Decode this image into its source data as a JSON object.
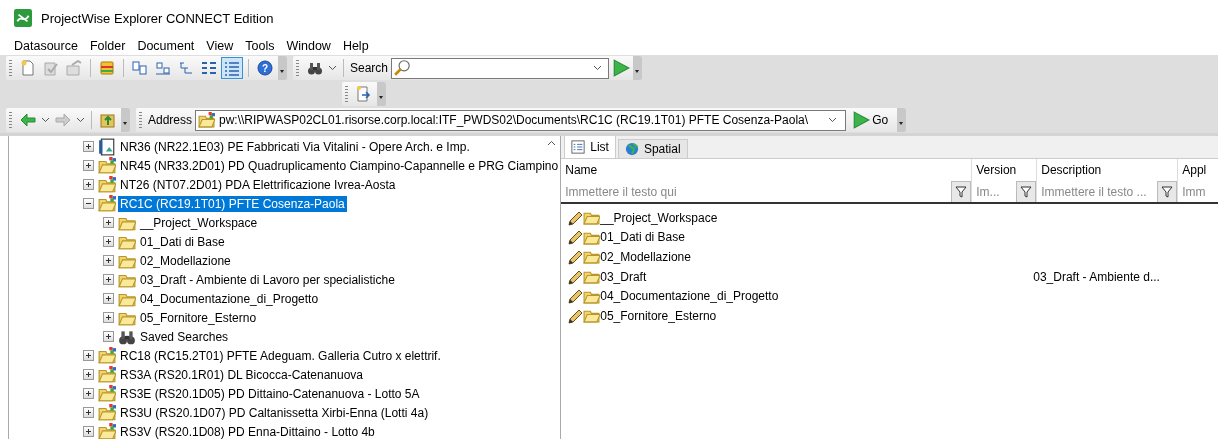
{
  "window": {
    "title": "ProjectWise Explorer CONNECT Edition"
  },
  "menu": [
    "Datasource",
    "Folder",
    "Document",
    "View",
    "Tools",
    "Window",
    "Help"
  ],
  "help": {
    "glyph": "?"
  },
  "search": {
    "label": "Search"
  },
  "address": {
    "label": "Address",
    "value": "pw:\\\\RIPWASP02CL01.risorse.corp.local:ITF_PWDS02\\Documents\\RC1C (RC19.1T01) PFTE Cosenza-Paola\\",
    "go": "Go"
  },
  "tree": {
    "items": [
      {
        "label": "NR36 (NR22.1E03) PE Fabbricati Via Vitalini - Opere Arch. e Imp.",
        "kind": "document",
        "expanded": false,
        "selected": false
      },
      {
        "label": "NR45 (NR33.2D01) PD Quadruplicamento Ciampino-Capannelle e PRG Ciampino",
        "kind": "project",
        "expanded": false,
        "selected": false
      },
      {
        "label": "NT26 (NT07.2D01) PDA Elettrificazione Ivrea-Aosta",
        "kind": "project",
        "expanded": false,
        "selected": false
      },
      {
        "label": "RC1C (RC19.1T01) PFTE Cosenza-Paola",
        "kind": "project",
        "expanded": true,
        "selected": true,
        "children": [
          {
            "label": "__Project_Workspace",
            "kind": "folder",
            "expanded": false,
            "selected": false
          },
          {
            "label": "01_Dati di Base",
            "kind": "folder",
            "expanded": false,
            "selected": false
          },
          {
            "label": "02_Modellazione",
            "kind": "folder",
            "expanded": false,
            "selected": false
          },
          {
            "label": "03_Draft - Ambiente di Lavoro per specialistiche",
            "kind": "folder",
            "expanded": false,
            "selected": false
          },
          {
            "label": "04_Documentazione_di_Progetto",
            "kind": "folder",
            "expanded": false,
            "selected": false
          },
          {
            "label": "05_Fornitore_Esterno",
            "kind": "folder",
            "expanded": false,
            "selected": false
          },
          {
            "label": "Saved Searches",
            "kind": "search",
            "expanded": false,
            "selected": false
          }
        ]
      },
      {
        "label": "RC18 (RC15.2T01) PFTE Adeguam. Galleria Cutro x elettrif.",
        "kind": "project",
        "expanded": false,
        "selected": false
      },
      {
        "label": "RS3A (RS20.1R01) DL Bicocca-Catenanuova",
        "kind": "project",
        "expanded": false,
        "selected": false
      },
      {
        "label": "RS3E (RS20.1D05) PD Dittaino-Catenanuova - Lotto 5A",
        "kind": "project",
        "expanded": false,
        "selected": false
      },
      {
        "label": "RS3U (RS20.1D07) PD Caltanissetta Xirbi-Enna (Lotti 4a)",
        "kind": "project",
        "expanded": false,
        "selected": false
      },
      {
        "label": "RS3V (RS20.1D08) PD Enna-Dittaino - Lotto 4b",
        "kind": "project",
        "expanded": false,
        "selected": false
      }
    ]
  },
  "tabs": [
    {
      "label": "List",
      "kind": "list",
      "selected": true
    },
    {
      "label": "Spatial",
      "kind": "globe",
      "selected": false
    }
  ],
  "table": {
    "columns": [
      {
        "name": "Name",
        "filter": "Immettere il testo qui"
      },
      {
        "name": "Version",
        "filter": "Im..."
      },
      {
        "name": "Description",
        "filter": "Immettere il testo ..."
      },
      {
        "name": "Appl",
        "filter": "Imm"
      }
    ],
    "rows": [
      {
        "name": "__Project_Workspace"
      },
      {
        "name": "01_Dati di Base"
      },
      {
        "name": "02_Modellazione"
      },
      {
        "name": "03_Draft",
        "description": "03_Draft - Ambiente d..."
      },
      {
        "name": "04_Documentazione_di_Progetto"
      },
      {
        "name": "05_Fornitore_Esterno"
      }
    ]
  }
}
